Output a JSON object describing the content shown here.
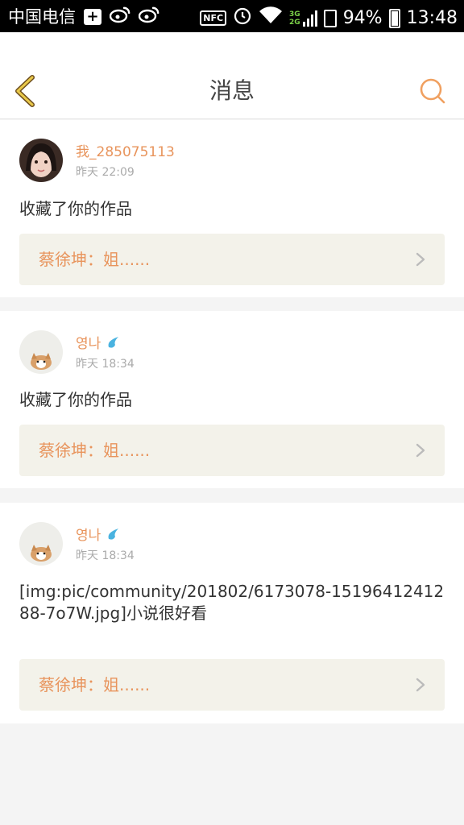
{
  "statusbar": {
    "carrier": "中国电信",
    "nfc": "NFC",
    "net_top": "3G",
    "net_bottom": "2G",
    "battery": "94%",
    "time": "13:48"
  },
  "header": {
    "title": "消息"
  },
  "colors": {
    "accent": "#e8945c",
    "ref_bg": "#f3f2ea",
    "page_bg": "#f4f4f4"
  },
  "messages": [
    {
      "user": "我_285075113",
      "time": "昨天 22:09",
      "content": "收藏了你的作品",
      "ref": "蔡徐坤：姐......"
    },
    {
      "user": "영나",
      "time": "昨天 18:34",
      "content": "收藏了你的作品",
      "ref": "蔡徐坤：姐......"
    },
    {
      "user": "영나",
      "time": "昨天 18:34",
      "content": "[img:pic/community/201802/6173078-1519641241288-7o7W.jpg]小说很好看",
      "ref": "蔡徐坤：姐......"
    }
  ]
}
